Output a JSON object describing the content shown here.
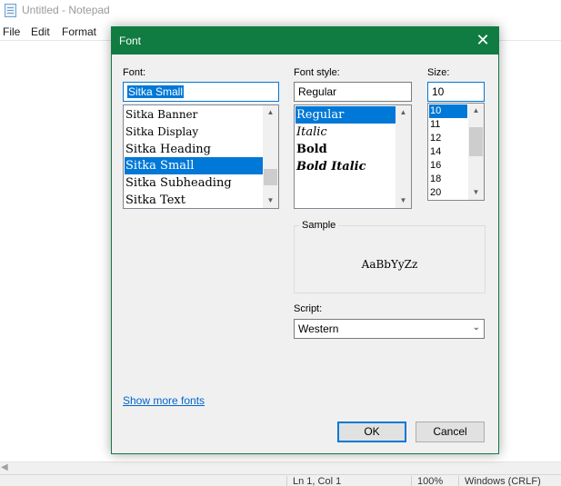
{
  "notepad": {
    "title": "Untitled - Notepad",
    "menu": [
      "File",
      "Edit",
      "Format"
    ],
    "status": {
      "position": "Ln 1, Col 1",
      "zoom": "100%",
      "encoding": "Windows (CRLF)"
    }
  },
  "dialog": {
    "title": "Font",
    "close_icon": "close-icon",
    "accent_color": "#107c41",
    "font": {
      "label": "Font:",
      "value": "Sitka Small",
      "items": [
        "Sitka Banner",
        "Sitka Display",
        "Sitka Heading",
        "Sitka Small",
        "Sitka Subheading",
        "Sitka Text"
      ],
      "selected_index": 3
    },
    "style": {
      "label": "Font style:",
      "value": "Regular",
      "items": [
        "Regular",
        "Italic",
        "Bold",
        "Bold Italic"
      ],
      "selected_index": 0
    },
    "size": {
      "label": "Size:",
      "value": "10",
      "items": [
        "10",
        "11",
        "12",
        "14",
        "16",
        "18",
        "20"
      ],
      "selected_index": 0
    },
    "sample": {
      "label": "Sample",
      "text": "AaBbYyZz"
    },
    "script": {
      "label": "Script:",
      "value": "Western"
    },
    "show_more_fonts": "Show more fonts",
    "ok_label": "OK",
    "cancel_label": "Cancel"
  }
}
